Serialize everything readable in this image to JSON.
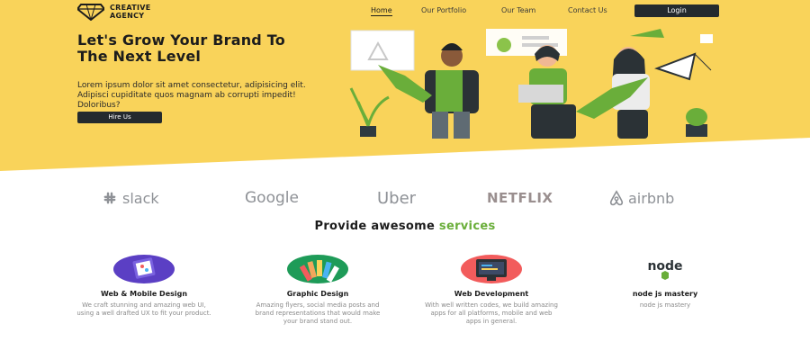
{
  "brand": {
    "line1": "CREATIVE",
    "line2": "AGENCY"
  },
  "nav": {
    "items": [
      {
        "label": "Home"
      },
      {
        "label": "Our Portfolio"
      },
      {
        "label": "Our Team"
      },
      {
        "label": "Contact Us"
      }
    ],
    "login_label": "Login"
  },
  "hero": {
    "title": "Let's Grow Your Brand To The Next Level",
    "description": "Lorem ipsum dolor sit amet consectetur, adipisicing elit. Adipisci cupiditate quos magnam ab corrupti impedit! Doloribus?",
    "cta_label": "Hire Us"
  },
  "clients": {
    "logos": [
      {
        "name": "slack",
        "icon": "slack-icon"
      },
      {
        "name": "Google"
      },
      {
        "name": "Uber"
      },
      {
        "name": "NETFLIX"
      },
      {
        "name": "airbnb",
        "icon": "airbnb-icon"
      }
    ]
  },
  "services": {
    "title_prefix": "Provide awesome",
    "title_accent": "services",
    "items": [
      {
        "title": "Web & Mobile Design",
        "description": "We craft stunning and amazing web UI, using a well drafted UX to fit your product.",
        "icon": "mobile-design-icon"
      },
      {
        "title": "Graphic Design",
        "description": "Amazing flyers, social media posts and brand representations that would make your brand stand out.",
        "icon": "color-palette-icon"
      },
      {
        "title": "Web Development",
        "description": "With well written codes, we build amazing apps for all platforms, mobile and web apps in general.",
        "icon": "code-monitor-icon"
      },
      {
        "title": "node js mastery",
        "description": "node js mastery",
        "icon": "nodejs-icon"
      }
    ]
  },
  "colors": {
    "hero_yellow": "#f9d35a",
    "accent_green": "#6aae3a",
    "dark_button": "#242a2e",
    "logo_gray": "#8e9196",
    "netflix_gray": "#9a8f8f"
  }
}
